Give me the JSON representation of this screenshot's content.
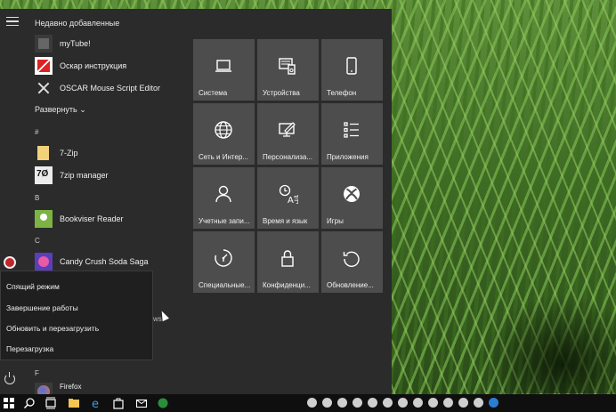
{
  "start_menu": {
    "recent_header": "Недавно добавленные",
    "recent_apps": [
      {
        "label": "myTube!",
        "icon": "mytube-icon"
      },
      {
        "label": "Оскар инструкция",
        "icon": "oskar-icon"
      },
      {
        "label": "OSCAR Mouse Script Editor",
        "icon": "oscar-icon"
      }
    ],
    "expand_label": "Развернуть",
    "groups": [
      {
        "letter": "#",
        "apps": [
          {
            "label": "7-Zip",
            "icon": "folder-icon"
          },
          {
            "label": "7zip manager",
            "icon": "7zip-manager-icon"
          }
        ]
      },
      {
        "letter": "B",
        "apps": [
          {
            "label": "Bookviser Reader",
            "icon": "bookviser-icon"
          }
        ]
      },
      {
        "letter": "C",
        "apps": [
          {
            "label": "Candy Crush Soda Saga",
            "icon": "candy-crush-icon"
          }
        ]
      },
      {
        "letter": "F",
        "apps": [
          {
            "label": "Firefox",
            "icon": "firefox-icon"
          }
        ]
      }
    ],
    "partial_text": "ws"
  },
  "power_menu": {
    "items": [
      "Спящий режим",
      "Завершение работы",
      "Обновить и перезагрузить",
      "Перезагрузка"
    ]
  },
  "tiles": [
    {
      "label": "Система",
      "icon": "laptop-icon"
    },
    {
      "label": "Устройства",
      "icon": "devices-icon"
    },
    {
      "label": "Телефон",
      "icon": "phone-icon"
    },
    {
      "label": "Сеть и Интер...",
      "icon": "globe-icon"
    },
    {
      "label": "Персонализа...",
      "icon": "personalization-icon"
    },
    {
      "label": "Приложения",
      "icon": "apps-list-icon"
    },
    {
      "label": "Учетные запи...",
      "icon": "person-icon"
    },
    {
      "label": "Время и язык",
      "icon": "time-language-icon"
    },
    {
      "label": "Игры",
      "icon": "xbox-icon"
    },
    {
      "label": "Специальные...",
      "icon": "ease-of-access-icon"
    },
    {
      "label": "Конфиденци...",
      "icon": "lock-icon"
    },
    {
      "label": "Обновление...",
      "icon": "update-icon"
    }
  ],
  "colors": {
    "menu_bg": "#2b2b2b",
    "tile_bg": "#4d4d4d",
    "taskbar_bg": "#0f0f0f",
    "accent": "#1e90ff"
  }
}
